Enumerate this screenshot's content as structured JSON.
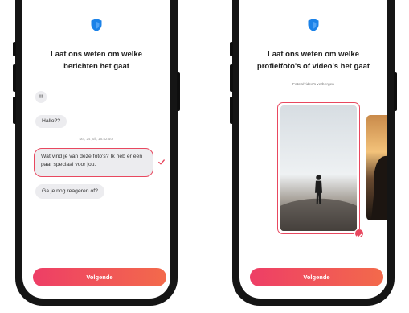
{
  "left_screen": {
    "title_line1": "Laat ons weten om welke",
    "title_line2": "berichten het gaat",
    "messages": [
      {
        "text": "!!!"
      },
      {
        "text": "Hallo??"
      },
      {
        "text": "Wat vind je van deze foto's? Ik heb er een paar speciaal voor jou.",
        "selected": true
      },
      {
        "text": "Ga je nog reageren of?"
      }
    ],
    "timestamp": "Ma, 24 juli, 16:42 uur",
    "next_button": "Volgende"
  },
  "right_screen": {
    "title_line1": "Laat ons weten om welke",
    "title_line2": "profielfoto's of video's het gaat",
    "subtitle": "Foto's/video's verbergen",
    "next_button": "Volgende"
  },
  "colors": {
    "accent": "#e8485f",
    "button_gradient_start": "#ee3e66",
    "button_gradient_end": "#f36a4b",
    "shield": "#1b82e8",
    "bubble": "#ececef",
    "phone_frame": "#151515"
  },
  "icons": [
    "shield-icon",
    "checkmark-icon"
  ]
}
